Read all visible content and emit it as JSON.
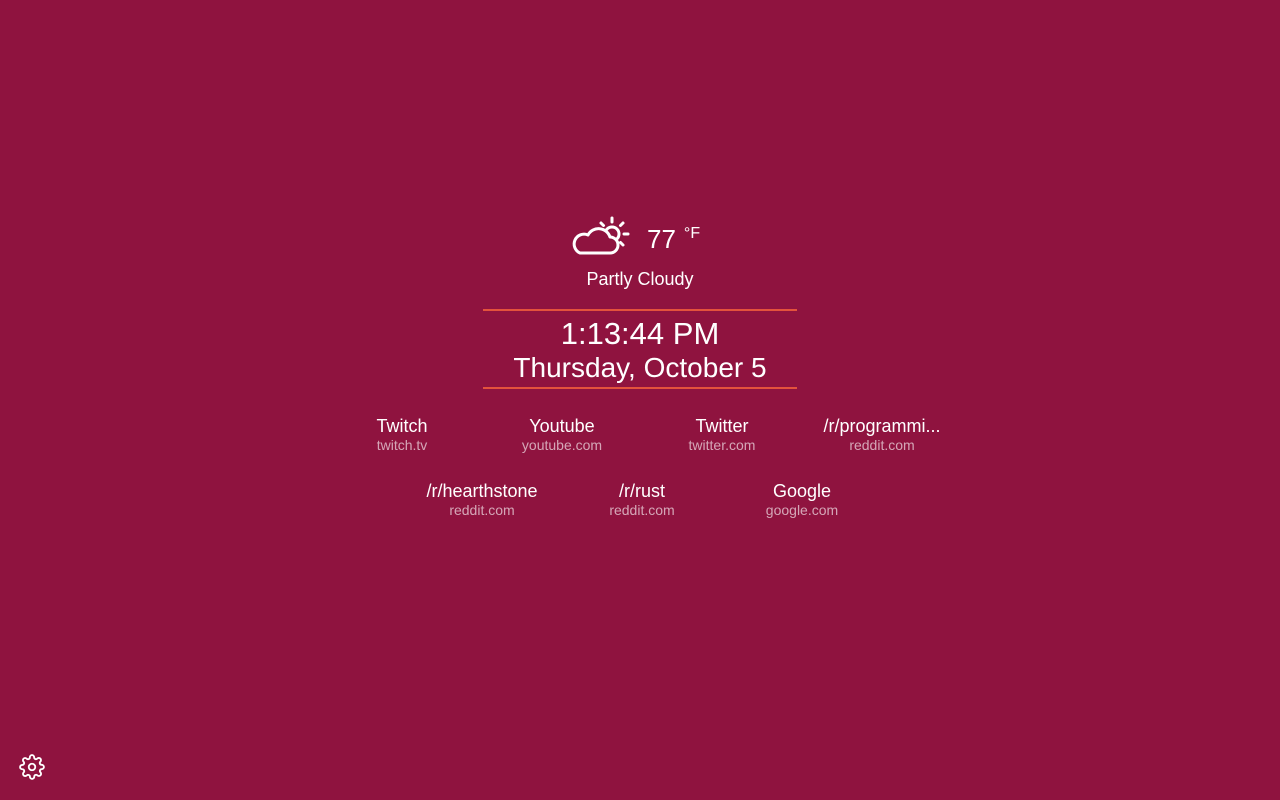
{
  "theme": {
    "background": "#8f133f",
    "accent": "#e3533c",
    "text": "#ffffff"
  },
  "weather": {
    "icon": "partly-cloudy-icon",
    "temperature": "77",
    "unit": "°F",
    "condition": "Partly Cloudy"
  },
  "clock": {
    "time": "1:13:44 PM",
    "date": "Thursday, October 5"
  },
  "shortcuts": [
    {
      "name": "Twitch",
      "domain": "twitch.tv"
    },
    {
      "name": "Youtube",
      "domain": "youtube.com"
    },
    {
      "name": "Twitter",
      "domain": "twitter.com"
    },
    {
      "name": "/r/programmi...",
      "domain": "reddit.com"
    },
    {
      "name": "/r/hearthstone",
      "domain": "reddit.com"
    },
    {
      "name": "/r/rust",
      "domain": "reddit.com"
    },
    {
      "name": "Google",
      "domain": "google.com"
    }
  ],
  "settings": {
    "icon": "gear-icon"
  }
}
